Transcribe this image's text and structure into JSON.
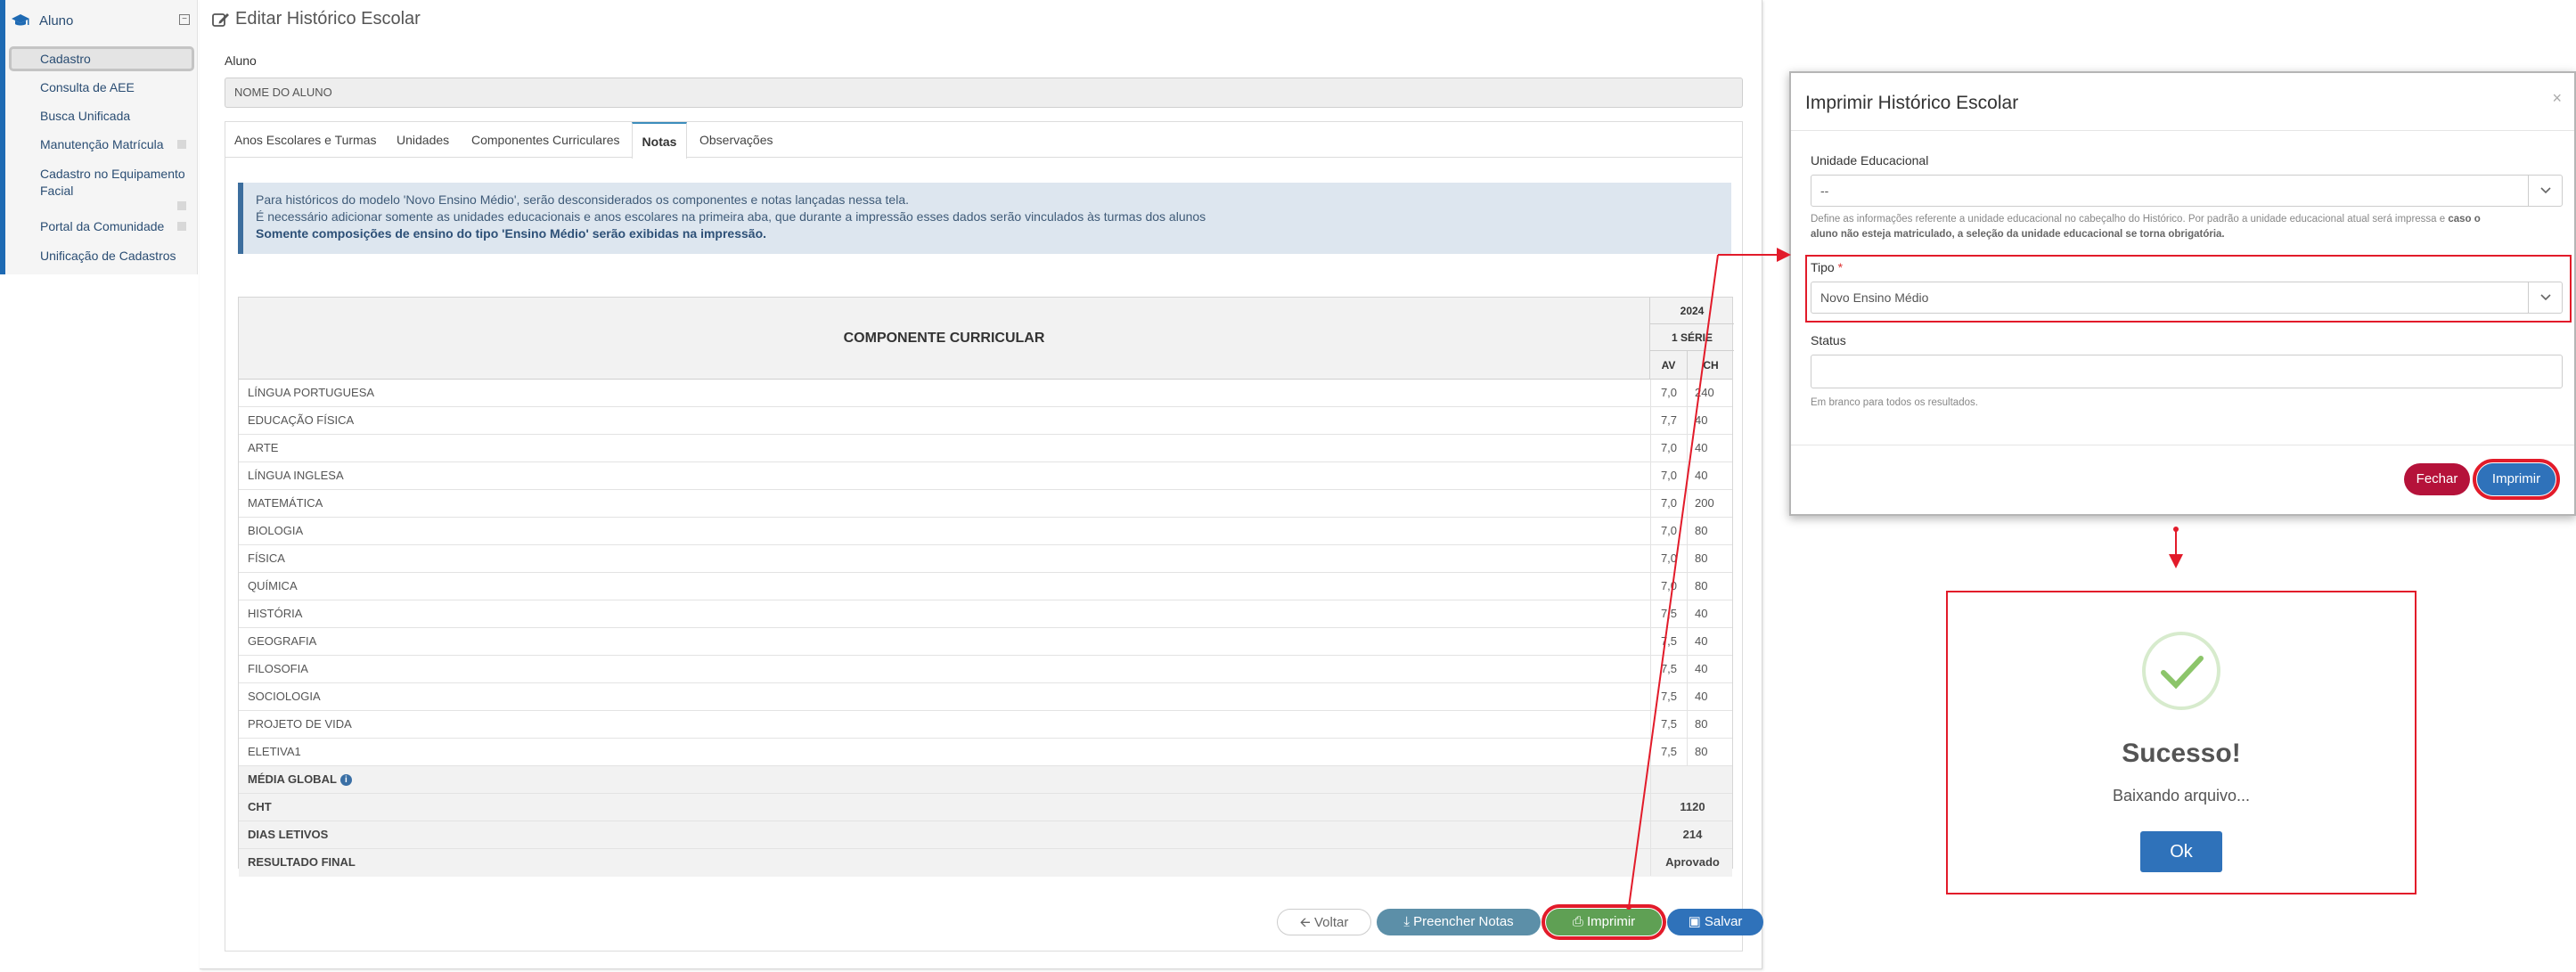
{
  "sidebar": {
    "header": "Aluno",
    "items": [
      {
        "label": "Cadastro",
        "active": true
      },
      {
        "label": "Consulta de AEE"
      },
      {
        "label": "Busca Unificada"
      },
      {
        "label": "Manutenção Matrícula"
      },
      {
        "label_line1": "Cadastro no Equipamento",
        "label_line2": "Facial"
      },
      {
        "label": "Portal da Comunidade"
      },
      {
        "label": "Unificação de Cadastros"
      }
    ]
  },
  "page": {
    "title": "Editar Histórico Escolar",
    "aluno_label": "Aluno",
    "aluno_value": "NOME DO ALUNO"
  },
  "tabs": [
    {
      "label": "Anos Escolares e Turmas"
    },
    {
      "label": "Unidades"
    },
    {
      "label": "Componentes Curriculares"
    },
    {
      "label": "Notas",
      "active": true
    },
    {
      "label": "Observações"
    }
  ],
  "alert": {
    "line1": "Para históricos do modelo 'Novo Ensino Médio', serão desconsiderados os componentes e notas lançadas nessa tela.",
    "line2": "É necessário adicionar somente as unidades educacionais e anos escolares na primeira aba, que durante a impressão esses dados serão vinculados às turmas dos alunos",
    "line3": "Somente composições de ensino do tipo 'Ensino Médio' serão exibidas na impressão."
  },
  "grades_table": {
    "header_main": "COMPONENTE CURRICULAR",
    "year": "2024",
    "serie": "1 SÉRIE",
    "col_av": "AV",
    "col_ch": "CH",
    "rows": [
      {
        "name": "LÍNGUA PORTUGUESA",
        "av": "7,0",
        "ch": "240"
      },
      {
        "name": "EDUCAÇÃO FÍSICA",
        "av": "7,7",
        "ch": "40"
      },
      {
        "name": "ARTE",
        "av": "7,0",
        "ch": "40"
      },
      {
        "name": "LÍNGUA INGLESA",
        "av": "7,0",
        "ch": "40"
      },
      {
        "name": "MATEMÁTICA",
        "av": "7,0",
        "ch": "200"
      },
      {
        "name": "BIOLOGIA",
        "av": "7,0",
        "ch": "80"
      },
      {
        "name": "FÍSICA",
        "av": "7,0",
        "ch": "80"
      },
      {
        "name": "QUÍMICA",
        "av": "7,0",
        "ch": "80"
      },
      {
        "name": "HISTÓRIA",
        "av": "7,5",
        "ch": "40"
      },
      {
        "name": "GEOGRAFIA",
        "av": "7,5",
        "ch": "40"
      },
      {
        "name": "FILOSOFIA",
        "av": "7,5",
        "ch": "40"
      },
      {
        "name": "SOCIOLOGIA",
        "av": "7,5",
        "ch": "40"
      },
      {
        "name": "PROJETO DE VIDA",
        "av": "7,5",
        "ch": "80"
      },
      {
        "name": "ELETIVA1",
        "av": "7,5",
        "ch": "80"
      }
    ],
    "summary": [
      {
        "name": "MÉDIA GLOBAL",
        "value": ""
      },
      {
        "name": "CHT",
        "value": "1120"
      },
      {
        "name": "DIAS LETIVOS",
        "value": "214"
      },
      {
        "name": "RESULTADO FINAL",
        "value": "Aprovado"
      }
    ]
  },
  "buttons": {
    "voltar": "Voltar",
    "preencher": "Preencher Notas",
    "imprimir": "Imprimir",
    "salvar": "Salvar"
  },
  "modal": {
    "title": "Imprimir Histórico Escolar",
    "close": "×",
    "unidade_label": "Unidade Educacional",
    "unidade_value": "--",
    "unidade_help_1": "Define as informações referente a unidade educacional no cabeçalho do Histórico. Por padrão a unidade educacional atual será impressa e ",
    "unidade_help_bold_1": "caso o",
    "unidade_help_bold_2": "aluno não esteja matriculado, a seleção da unidade educacional se torna obrigatória.",
    "tipo_label": "Tipo",
    "tipo_required": "*",
    "tipo_value": "Novo Ensino Médio",
    "status_label": "Status",
    "status_value": "",
    "status_help": "Em branco para todos os resultados.",
    "fechar": "Fechar",
    "imprimir": "Imprimir"
  },
  "success": {
    "title": "Sucesso!",
    "text": "Baixando arquivo...",
    "ok": "Ok"
  },
  "colors": {
    "highlight": "#e21b2a",
    "primary": "#2f72ba",
    "success_btn": "#5fa054",
    "info_btn": "#5c8fa8",
    "danger": "#b5123a",
    "check": "#8cc56a"
  }
}
